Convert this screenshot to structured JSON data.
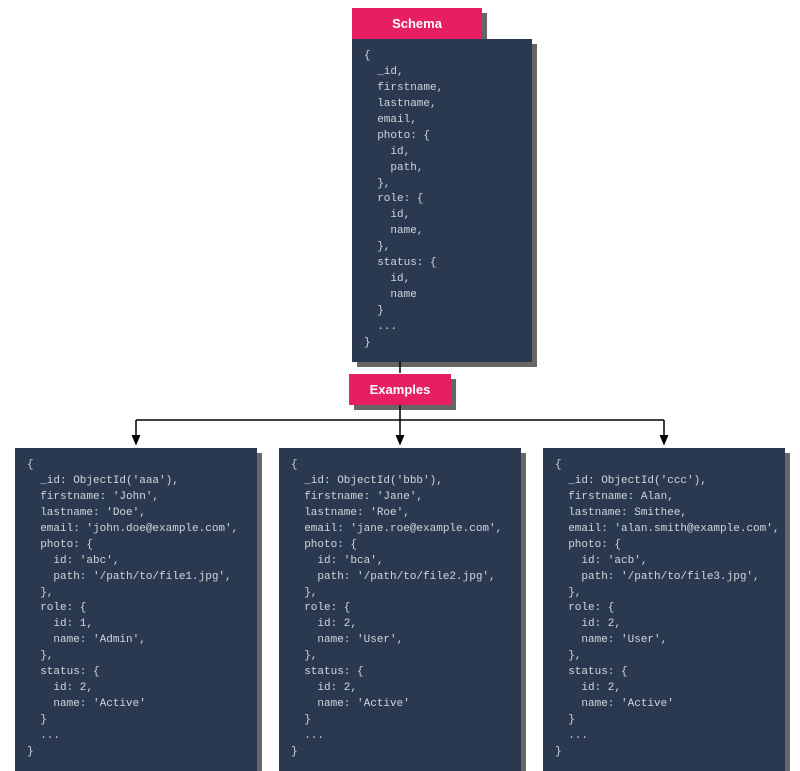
{
  "schema": {
    "title": "Schema",
    "code": "{\n  _id,\n  firstname,\n  lastname,\n  email,\n  photo: {\n    id,\n    path,\n  },\n  role: {\n    id,\n    name,\n  },\n  status: {\n    id,\n    name\n  }\n  ...\n}"
  },
  "examples_label": "Examples",
  "examples": [
    {
      "code": "{\n  _id: ObjectId('aaa'),\n  firstname: 'John',\n  lastname: 'Doe',\n  email: 'john.doe@example.com',\n  photo: {\n    id: 'abc',\n    path: '/path/to/file1.jpg',\n  },\n  role: {\n    id: 1,\n    name: 'Admin',\n  },\n  status: {\n    id: 2,\n    name: 'Active'\n  }\n  ...\n}"
    },
    {
      "code": "{\n  _id: ObjectId('bbb'),\n  firstname: 'Jane',\n  lastname: 'Roe',\n  email: 'jane.roe@example.com',\n  photo: {\n    id: 'bca',\n    path: '/path/to/file2.jpg',\n  },\n  role: {\n    id: 2,\n    name: 'User',\n  },\n  status: {\n    id: 2,\n    name: 'Active'\n  }\n  ...\n}"
    },
    {
      "code": "{\n  _id: ObjectId('ccc'),\n  firstname: Alan,\n  lastname: Smithee,\n  email: 'alan.smith@example.com',\n  photo: {\n    id: 'acb',\n    path: '/path/to/file3.jpg',\n  },\n  role: {\n    id: 2,\n    name: 'User',\n  },\n  status: {\n    id: 2,\n    name: 'Active'\n  }\n  ...\n}"
    }
  ]
}
